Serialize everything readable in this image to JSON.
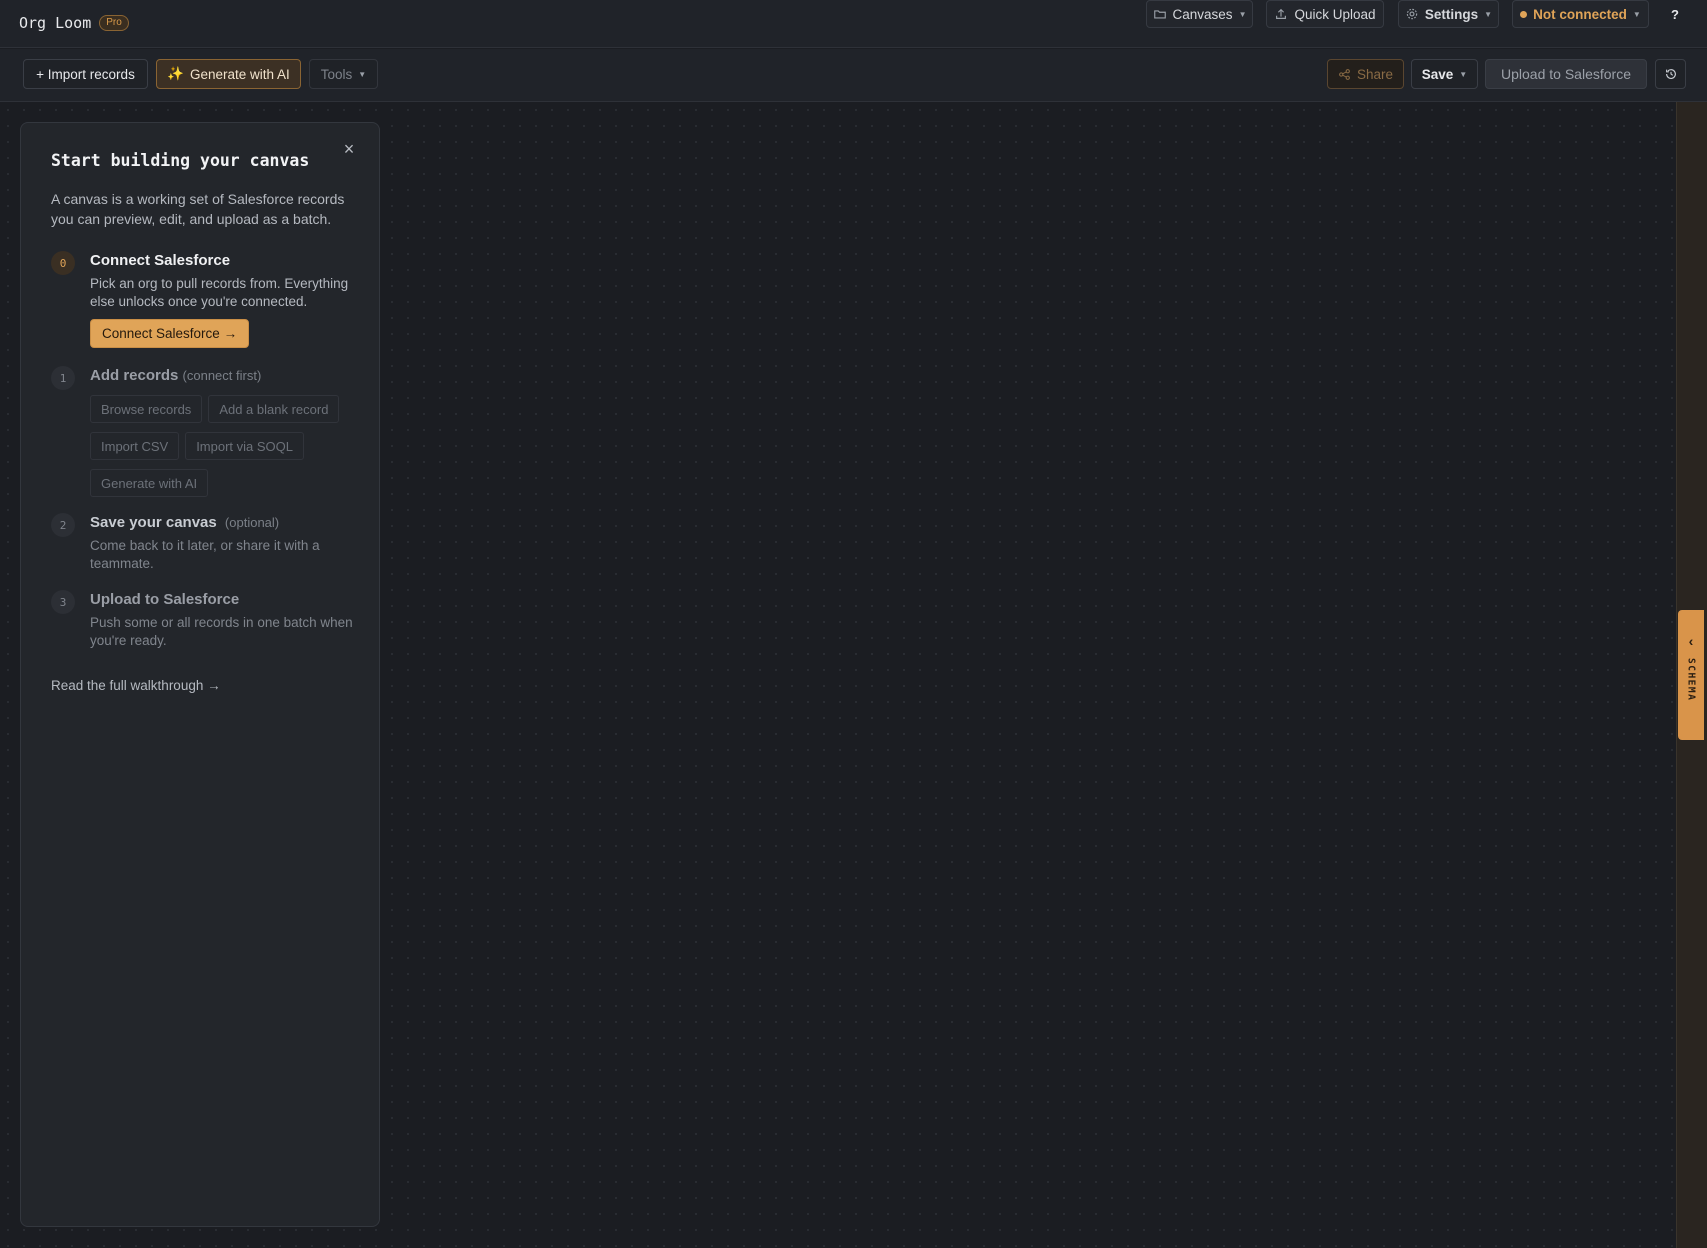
{
  "app": {
    "brand": "Org Loom",
    "badge": "Pro"
  },
  "topbar": {
    "canvases": "Canvases",
    "quick_upload": "Quick Upload",
    "settings": "Settings",
    "connection_status": "Not connected",
    "help": "?"
  },
  "toolbar": {
    "import_records": "+ Import records",
    "generate_ai": "Generate with AI",
    "tools": "Tools",
    "share": "Share",
    "save": "Save",
    "upload": "Upload to Salesforce"
  },
  "schema_tab": {
    "label": "SCHEMA"
  },
  "onboarding": {
    "close": "×",
    "title": "Start building your canvas",
    "intro": "A canvas is a working set of Salesforce records you can preview, edit, and upload as a batch.",
    "steps": [
      {
        "num": "0",
        "title": "Connect Salesforce",
        "desc": "Pick an org to pull records from. Everything else unlocks once you're connected.",
        "action": "Connect Salesforce →"
      },
      {
        "num": "1",
        "title": "Add records",
        "hint": "(connect first)",
        "chips": [
          "Browse records",
          "Add a blank record",
          "Import CSV",
          "Import via SOQL",
          "Generate with AI"
        ]
      },
      {
        "num": "2",
        "title": "Save your canvas",
        "hint": "(optional)",
        "desc": "Come back to it later, or share it with a teammate."
      },
      {
        "num": "3",
        "title": "Upload to Salesforce",
        "desc": "Push some or all records in one batch when you're ready."
      }
    ],
    "walkthrough": "Read the full walkthrough →"
  },
  "colors": {
    "accent": "#e0a458",
    "background": "#1b1d22",
    "panel": "#23262b"
  }
}
